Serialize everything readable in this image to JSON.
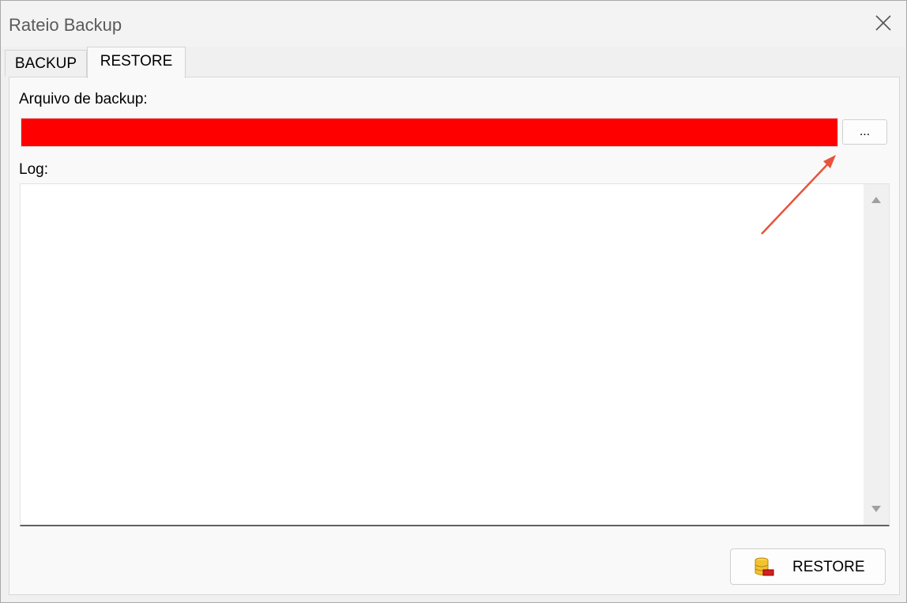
{
  "window": {
    "title": "Rateio Backup"
  },
  "tabs": [
    {
      "label": "BACKUP",
      "active": false
    },
    {
      "label": "RESTORE",
      "active": true
    }
  ],
  "restore_panel": {
    "backup_file_label": "Arquivo de backup:",
    "backup_file_value": "",
    "backup_file_highlight_color": "#ff0000",
    "browse_button_label": "...",
    "log_label": "Log:",
    "log_text": "",
    "restore_button_label": "RESTORE",
    "restore_button_icon": "database-restore-icon"
  },
  "annotation": {
    "type": "arrow",
    "color": "#e8533a",
    "points_to": "browse-button"
  }
}
